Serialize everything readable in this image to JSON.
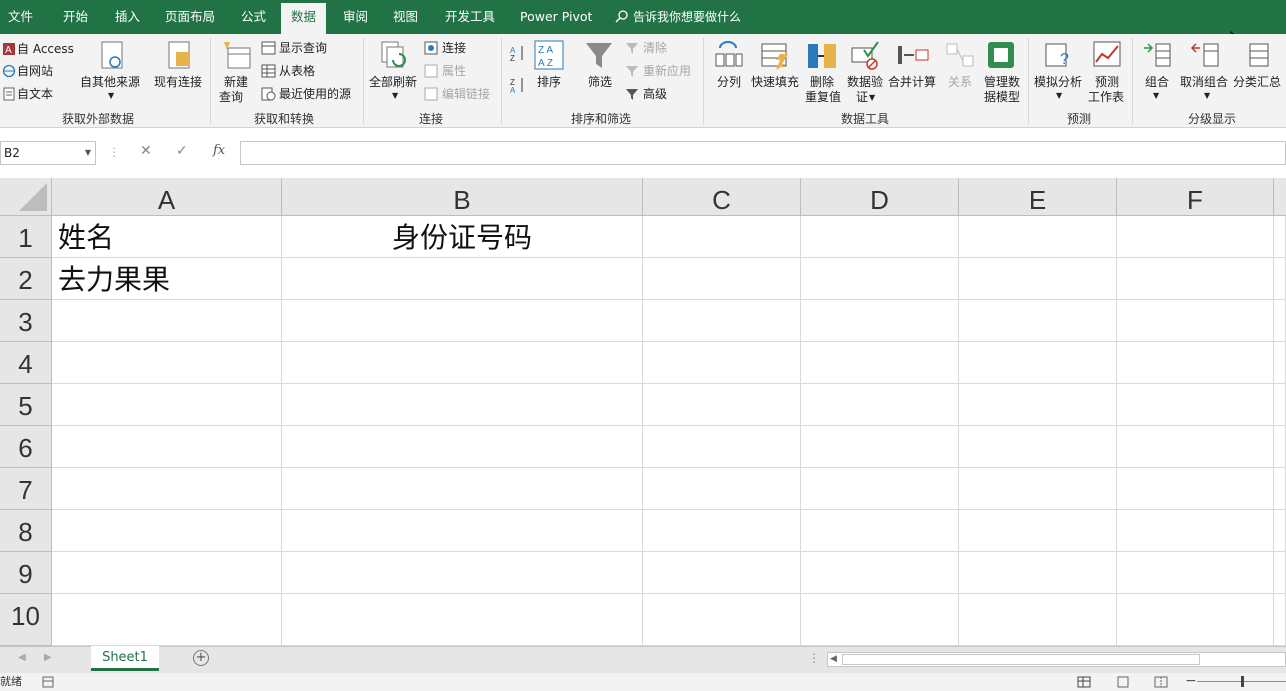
{
  "menu": {
    "tabs": [
      "文件",
      "开始",
      "插入",
      "页面布局",
      "公式",
      "数据",
      "审阅",
      "视图",
      "开发工具",
      "Power Pivot"
    ],
    "active_tab": "数据",
    "tell_me": "告诉我你想要做什么"
  },
  "ribbon": {
    "groups": {
      "external": "获取外部数据",
      "transform": "获取和转换",
      "connections": "连接",
      "sort_filter": "排序和筛选",
      "data_tools": "数据工具",
      "forecast": "预测",
      "outline": "分级显示"
    },
    "buttons": {
      "access": "自 Access",
      "web": "自网站",
      "text": "自文本",
      "other_sources": "自其他来源",
      "existing_connections": "现有连接",
      "new_query_1": "新建",
      "new_query_2": "查询",
      "show_queries": "显示查询",
      "from_table": "从表格",
      "recent_sources": "最近使用的源",
      "refresh_all": "全部刷新",
      "connections": "连接",
      "properties": "属性",
      "edit_links": "编辑链接",
      "sort": "排序",
      "filter": "筛选",
      "clear": "清除",
      "reapply": "重新应用",
      "advanced": "高级",
      "text_to_columns": "分列",
      "flash_fill": "快速填充",
      "remove_dup_1": "删除",
      "remove_dup_2": "重复值",
      "validation_1": "数据验",
      "validation_2": "证",
      "consolidate": "合并计算",
      "relationships": "关系",
      "manage_model_1": "管理数",
      "manage_model_2": "据模型",
      "what_if": "模拟分析",
      "forecast_1": "预测",
      "forecast_2": "工作表",
      "group": "组合",
      "ungroup": "取消组合",
      "subtotal": "分类汇总"
    }
  },
  "formula_bar": {
    "name_box": "B2",
    "fx": "fx",
    "value": ""
  },
  "sheet": {
    "columns": [
      "A",
      "B",
      "C",
      "D",
      "E",
      "F"
    ],
    "rows": [
      "1",
      "2",
      "3",
      "4",
      "5",
      "6",
      "7",
      "8",
      "9",
      "10"
    ],
    "cells": {
      "A1": "姓名",
      "B1": "身份证号码",
      "A2": "去力果果"
    }
  },
  "tabs": {
    "sheet1": "Sheet1",
    "add": "+"
  },
  "status": {
    "ready": "就绪"
  },
  "colors": {
    "excel_green": "#217346",
    "ribbon_bg": "#f3f3f3",
    "header_bg": "#e6e6e6"
  }
}
